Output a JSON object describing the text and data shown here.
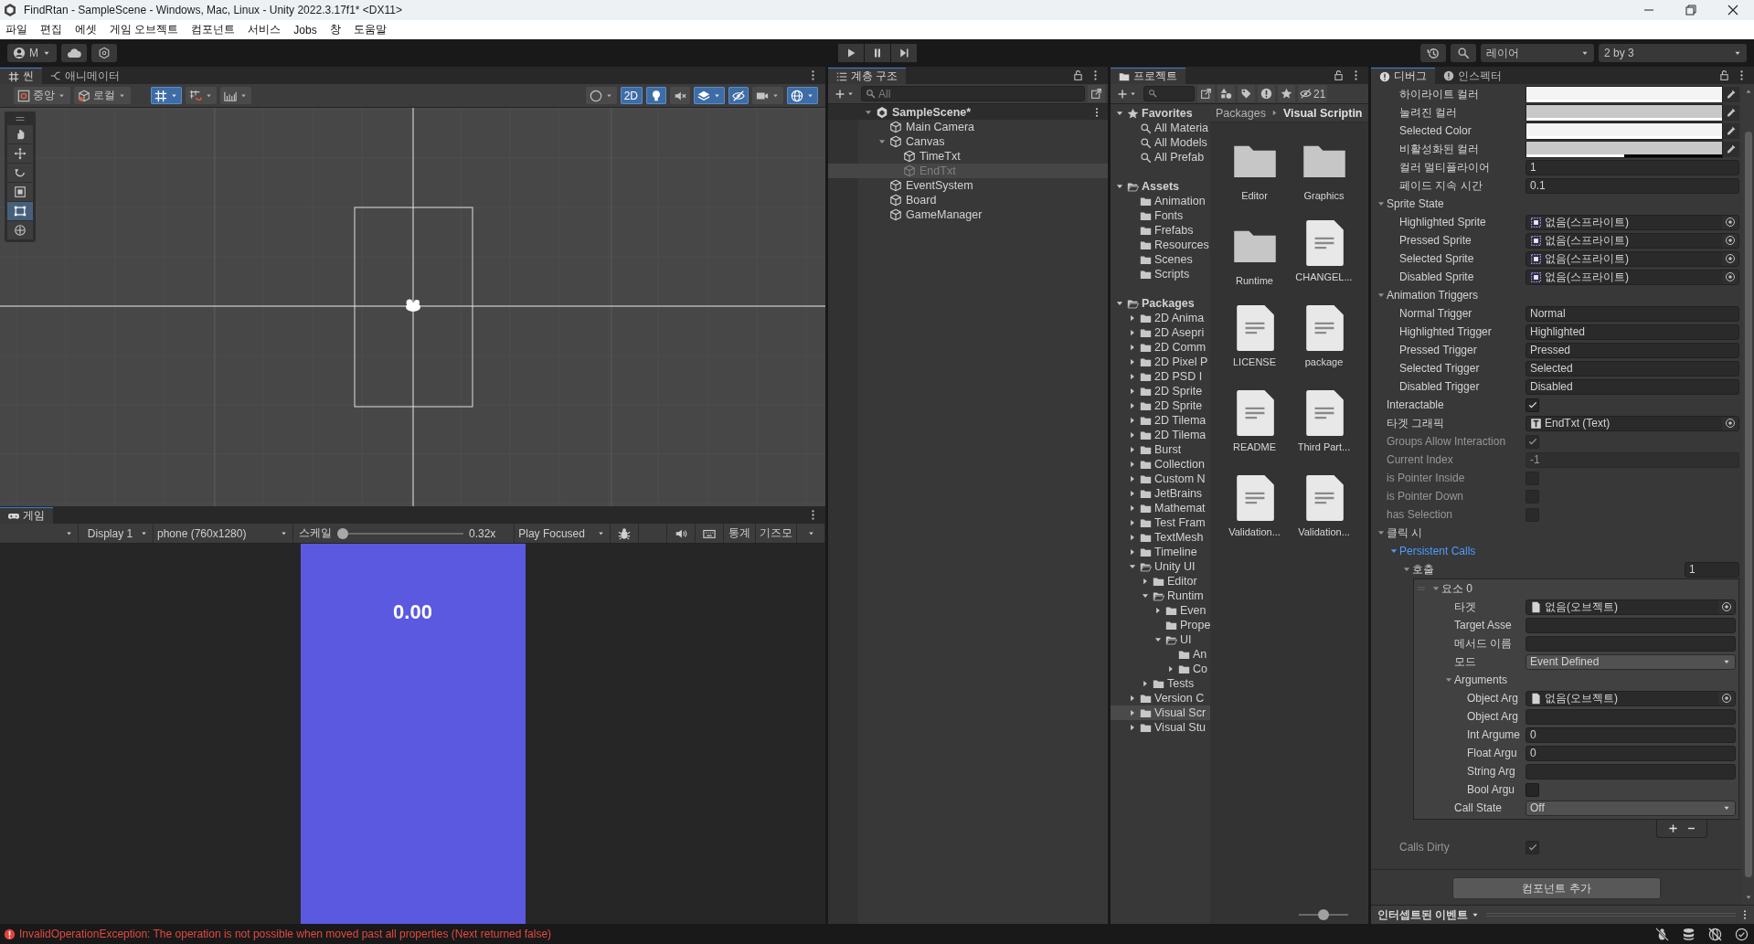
{
  "window": {
    "title": "FindRtan - SampleScene - Windows, Mac, Linux - Unity 2022.3.17f1* <DX11>"
  },
  "menu": [
    "파일",
    "편집",
    "에셋",
    "게임 오브젝트",
    "컴포넌트",
    "서비스",
    "Jobs",
    "창",
    "도움말"
  ],
  "toolbar": {
    "account": "M",
    "layers": "레이어",
    "layout": "2 by 3"
  },
  "scene": {
    "tabs": [
      {
        "label": "씬",
        "kind": "scene",
        "selected": true
      },
      {
        "label": "애니메이터",
        "kind": "animator",
        "selected": false
      }
    ],
    "controls": [
      {
        "kind": "pivot",
        "label": "중앙",
        "on": false
      },
      {
        "kind": "space",
        "label": "로컬",
        "on": false
      },
      {
        "kind": "grid",
        "on": true
      },
      {
        "kind": "snap",
        "on": false
      },
      {
        "kind": "increment",
        "on": false
      },
      {
        "kind": "shading",
        "on": false
      },
      {
        "kind": "mode2d",
        "label": "2D",
        "on": true
      },
      {
        "kind": "light",
        "on": true
      },
      {
        "kind": "audio",
        "on": false
      },
      {
        "kind": "effects",
        "on": true
      },
      {
        "kind": "visibility",
        "on": true
      },
      {
        "kind": "camera",
        "on": false
      },
      {
        "kind": "gizmos",
        "on": true
      }
    ],
    "tools": [
      {
        "kind": "hand",
        "selected": false
      },
      {
        "kind": "move",
        "selected": false
      },
      {
        "kind": "rotate",
        "selected": false
      },
      {
        "kind": "scale",
        "selected": false
      },
      {
        "kind": "rect",
        "selected": true
      },
      {
        "kind": "transform",
        "selected": false
      }
    ]
  },
  "game": {
    "tab": "게임",
    "display": "Display 1",
    "resolution": "phone (760x1280)",
    "scale_label": "스케일",
    "scale": {
      "level": 0
    },
    "scale_value": "0.32x",
    "play_mode": "Play Focused",
    "stats": "통계",
    "gizmos": "기즈모",
    "screen_text": "0.00"
  },
  "hierarchy": {
    "title": "계층 구조",
    "search_placeholder": "All",
    "items": [
      {
        "label": "SampleScene*",
        "kind": "scene",
        "expanded": true,
        "selected": false,
        "active": true,
        "children": [
          {
            "label": "Main Camera",
            "kind": "object",
            "selected": false,
            "active": true
          },
          {
            "label": "Canvas",
            "kind": "object",
            "expanded": true,
            "selected": false,
            "active": true,
            "children": [
              {
                "label": "TimeTxt",
                "kind": "object",
                "selected": false,
                "active": true
              },
              {
                "label": "EndTxt",
                "kind": "object",
                "selected": true,
                "active": false
              }
            ]
          },
          {
            "label": "EventSystem",
            "kind": "object",
            "selected": false,
            "active": true
          },
          {
            "label": "Board",
            "kind": "object",
            "selected": false,
            "active": true
          },
          {
            "label": "GameManager",
            "kind": "object",
            "selected": false,
            "active": true
          }
        ]
      }
    ]
  },
  "project": {
    "title": "프로젝트",
    "hidden_count": "21",
    "icon_size": {
      "level": 0.5
    },
    "tree": [
      {
        "label": "Favorites",
        "kind": "favorites",
        "expanded": true,
        "selected": false,
        "children": [
          {
            "label": "All Materia",
            "kind": "search",
            "selected": false
          },
          {
            "label": "All Models",
            "kind": "search",
            "selected": false
          },
          {
            "label": "All Prefab",
            "kind": "search",
            "selected": false
          }
        ]
      },
      {
        "label": "Assets",
        "kind": "root",
        "expanded": true,
        "selected": false,
        "children": [
          {
            "label": "Animation",
            "kind": "folder",
            "selected": false
          },
          {
            "label": "Fonts",
            "kind": "folder",
            "selected": false
          },
          {
            "label": "Frefabs",
            "kind": "folder",
            "selected": false
          },
          {
            "label": "Resources",
            "kind": "folder",
            "selected": false
          },
          {
            "label": "Scenes",
            "kind": "folder",
            "selected": false
          },
          {
            "label": "Scripts",
            "kind": "folder",
            "selected": false
          }
        ]
      },
      {
        "label": "Packages",
        "kind": "root",
        "expanded": true,
        "selected": false,
        "children": [
          {
            "label": "2D Anima",
            "kind": "folder",
            "expanded": false,
            "selected": false
          },
          {
            "label": "2D Asepri",
            "kind": "folder",
            "expanded": false,
            "selected": false
          },
          {
            "label": "2D Comm",
            "kind": "folder",
            "expanded": false,
            "selected": false
          },
          {
            "label": "2D Pixel P",
            "kind": "folder",
            "expanded": false,
            "selected": false
          },
          {
            "label": "2D PSD I",
            "kind": "folder",
            "expanded": false,
            "selected": false
          },
          {
            "label": "2D Sprite",
            "kind": "folder",
            "expanded": false,
            "selected": false
          },
          {
            "label": "2D Sprite",
            "kind": "folder",
            "expanded": false,
            "selected": false
          },
          {
            "label": "2D Tilema",
            "kind": "folder",
            "expanded": false,
            "selected": false
          },
          {
            "label": "2D Tilema",
            "kind": "folder",
            "expanded": false,
            "selected": false
          },
          {
            "label": "Burst",
            "kind": "folder",
            "expanded": false,
            "selected": false
          },
          {
            "label": "Collection",
            "kind": "folder",
            "expanded": false,
            "selected": false
          },
          {
            "label": "Custom N",
            "kind": "folder",
            "expanded": false,
            "selected": false
          },
          {
            "label": "JetBrains",
            "kind": "folder",
            "expanded": false,
            "selected": false
          },
          {
            "label": "Mathemat",
            "kind": "folder",
            "expanded": false,
            "selected": false
          },
          {
            "label": "Test Fram",
            "kind": "folder",
            "expanded": false,
            "selected": false
          },
          {
            "label": "TextMesh",
            "kind": "folder",
            "expanded": false,
            "selected": false
          },
          {
            "label": "Timeline",
            "kind": "folder",
            "expanded": false,
            "selected": false
          },
          {
            "label": "Unity UI",
            "kind": "folder",
            "expanded": true,
            "selected": false,
            "children": [
              {
                "label": "Editor",
                "kind": "folder",
                "expanded": false,
                "selected": false
              },
              {
                "label": "Runtim",
                "kind": "folder",
                "expanded": true,
                "selected": false,
                "children": [
                  {
                    "label": "Even",
                    "kind": "folder",
                    "expanded": false,
                    "selected": false
                  },
                  {
                    "label": "Prope",
                    "kind": "folder",
                    "selected": false
                  },
                  {
                    "label": "UI",
                    "kind": "folder",
                    "expanded": true,
                    "selected": false,
                    "children": [
                      {
                        "label": "An",
                        "kind": "folder",
                        "selected": false
                      },
                      {
                        "label": "Co",
                        "kind": "folder",
                        "expanded": false,
                        "selected": false
                      }
                    ]
                  }
                ]
              },
              {
                "label": "Tests",
                "kind": "folder",
                "expanded": false,
                "selected": false
              }
            ]
          },
          {
            "label": "Version C",
            "kind": "folder",
            "expanded": false,
            "selected": false
          },
          {
            "label": "Visual Scr",
            "kind": "folder",
            "expanded": false,
            "selected": true
          },
          {
            "label": "Visual Stu",
            "kind": "folder",
            "expanded": false,
            "selected": false
          }
        ]
      }
    ],
    "breadcrumb": [
      "Packages",
      "Visual Scriptin"
    ],
    "items": [
      {
        "label": "Editor",
        "kind": "folder"
      },
      {
        "label": "Graphics",
        "kind": "folder"
      },
      {
        "label": "Runtime",
        "kind": "folder"
      },
      {
        "label": "CHANGEL...",
        "kind": "file"
      },
      {
        "label": "LICENSE",
        "kind": "file"
      },
      {
        "label": "package",
        "kind": "file"
      },
      {
        "label": "README",
        "kind": "file"
      },
      {
        "label": "Third Part...",
        "kind": "file"
      },
      {
        "label": "Validation...",
        "kind": "file"
      },
      {
        "label": "Validation...",
        "kind": "file"
      }
    ]
  },
  "inspector": {
    "tabs": [
      {
        "label": "디버그",
        "selected": true
      },
      {
        "label": "인스펙터",
        "selected": false
      }
    ],
    "properties": [
      {
        "kind": "group",
        "children": [
          {
            "kind": "color",
            "label": "하이라이트 컬러",
            "color": "#f4f4f4",
            "level": 1,
            "disabled": false
          },
          {
            "kind": "color",
            "label": "눌려진 컬러",
            "color": "#c8c8c8",
            "level": 1,
            "disabled": false
          },
          {
            "kind": "color",
            "label": "Selected Color",
            "color": "#f4f4f4",
            "level": 1,
            "disabled": false
          },
          {
            "kind": "color",
            "label": "비활성화된 컬러",
            "color": "#c8c8c8",
            "level": 0.5,
            "disabled": false
          },
          {
            "kind": "text",
            "label": "컬러 멀티플라이어",
            "value": "1",
            "disabled": false
          },
          {
            "kind": "text",
            "label": "페이드 지속 시간",
            "value": "0.1",
            "disabled": false
          }
        ]
      },
      {
        "kind": "foldout",
        "label": "Sprite State",
        "expanded": true,
        "children": [
          {
            "kind": "sprite_ref",
            "label": "Highlighted Sprite",
            "value": "없음(스프라이트)",
            "disabled": false
          },
          {
            "kind": "sprite_ref",
            "label": "Pressed Sprite",
            "value": "없음(스프라이트)",
            "disabled": false
          },
          {
            "kind": "sprite_ref",
            "label": "Selected Sprite",
            "value": "없음(스프라이트)",
            "disabled": false
          },
          {
            "kind": "sprite_ref",
            "label": "Disabled Sprite",
            "value": "없음(스프라이트)",
            "disabled": false
          }
        ]
      },
      {
        "kind": "foldout",
        "label": "Animation Triggers",
        "expanded": true,
        "children": [
          {
            "kind": "text",
            "label": "Normal Trigger",
            "value": "Normal",
            "disabled": false
          },
          {
            "kind": "text",
            "label": "Highlighted Trigger",
            "value": "Highlighted",
            "disabled": false
          },
          {
            "kind": "text",
            "label": "Pressed Trigger",
            "value": "Pressed",
            "disabled": false
          },
          {
            "kind": "text",
            "label": "Selected Trigger",
            "value": "Selected",
            "disabled": false
          },
          {
            "kind": "text",
            "label": "Disabled Trigger",
            "value": "Disabled",
            "disabled": false
          }
        ]
      },
      {
        "kind": "checkbox",
        "label": "Interactable",
        "checked": true,
        "disabled": false
      },
      {
        "kind": "component_ref",
        "label": "타겟 그래픽",
        "value": "EndTxt (Text)",
        "disabled": false
      },
      {
        "kind": "checkbox",
        "label": "Groups Allow Interaction",
        "checked": true,
        "disabled": true
      },
      {
        "kind": "text",
        "label": "Current Index",
        "value": "-1",
        "disabled": true
      },
      {
        "kind": "checkbox",
        "label": "is Pointer Inside",
        "checked": false,
        "disabled": true
      },
      {
        "kind": "checkbox",
        "label": "is Pointer Down",
        "checked": false,
        "disabled": true
      },
      {
        "kind": "checkbox",
        "label": "has Selection",
        "checked": false,
        "disabled": true
      },
      {
        "kind": "foldout",
        "label": "클릭 시",
        "expanded": true,
        "children": [
          {
            "kind": "foldout",
            "label": "Persistent Calls",
            "expanded": true,
            "highlighted": true,
            "children": [
              {
                "kind": "array",
                "label": "호출",
                "value": "1",
                "expanded": true,
                "children": [
                  {
                    "kind": "element",
                    "label": "요소 0",
                    "expanded": true,
                    "children": [
                      {
                        "kind": "object_ref",
                        "label": "타겟",
                        "value": "없음(오브젝트)",
                        "disabled": false
                      },
                      {
                        "kind": "text",
                        "label": "Target Asse",
                        "disabled": false
                      },
                      {
                        "kind": "text",
                        "label": "메서드 이름",
                        "disabled": false
                      },
                      {
                        "kind": "dropdown",
                        "label": "모드",
                        "value": "Event Defined",
                        "disabled": false
                      },
                      {
                        "kind": "foldout",
                        "label": "Arguments",
                        "expanded": true,
                        "children": [
                          {
                            "kind": "object_ref",
                            "label": "Object Arg",
                            "value": "없음(오브젝트)",
                            "disabled": false
                          },
                          {
                            "kind": "text",
                            "label": "Object Arg",
                            "disabled": false
                          },
                          {
                            "kind": "text",
                            "label": "Int Argume",
                            "value": "0",
                            "disabled": false
                          },
                          {
                            "kind": "text",
                            "label": "Float Argu",
                            "value": "0",
                            "disabled": false
                          },
                          {
                            "kind": "text",
                            "label": "String Arg",
                            "disabled": false
                          },
                          {
                            "kind": "checkbox",
                            "label": "Bool Argu",
                            "checked": false,
                            "disabled": false
                          }
                        ]
                      },
                      {
                        "kind": "dropdown",
                        "label": "Call State",
                        "value": "Off",
                        "disabled": false
                      }
                    ]
                  }
                ]
              }
            ]
          },
          {
            "kind": "checkbox",
            "label": "Calls Dirty",
            "checked": true,
            "disabled": true
          }
        ]
      }
    ],
    "add_component": "컴포넌트 추가",
    "intercepted_events": "인터셉트된 이벤트"
  },
  "status": {
    "kind": "error",
    "message": "InvalidOperationException: The operation is not possible when moved past all properties (Next returned false)"
  }
}
